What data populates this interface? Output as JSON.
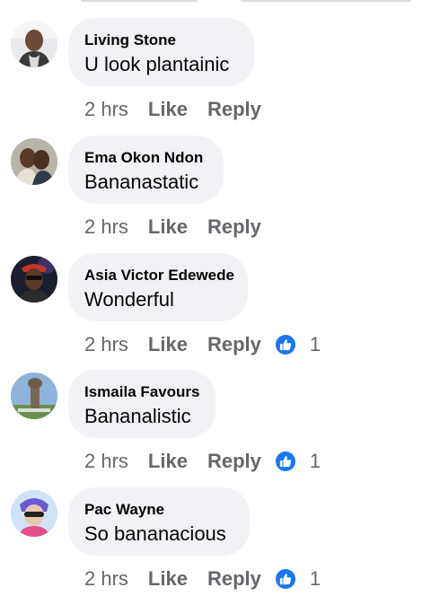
{
  "colors": {
    "bubble": "#f0f2f5",
    "secondary_text": "#65676b",
    "like_blue": "#1877f2"
  },
  "comments": [
    {
      "author": "Living Stone",
      "text": "U look plantainic",
      "time": "2 hrs",
      "like_label": "Like",
      "reply_label": "Reply",
      "reaction_count": null,
      "avatar": "avatar-living-stone"
    },
    {
      "author": "Ema Okon Ndon",
      "text": "Bananastatic",
      "time": "2 hrs",
      "like_label": "Like",
      "reply_label": "Reply",
      "reaction_count": null,
      "avatar": "avatar-ema-okon-ndon"
    },
    {
      "author": "Asia Victor Edewede",
      "text": "Wonderful",
      "time": "2 hrs",
      "like_label": "Like",
      "reply_label": "Reply",
      "reaction_count": "1",
      "reaction_icon": "thumbs-up-icon",
      "avatar": "avatar-asia-victor-edewede"
    },
    {
      "author": "Ismaila Favours",
      "text": "Bananalistic",
      "time": "2 hrs",
      "like_label": "Like",
      "reply_label": "Reply",
      "reaction_count": "1",
      "reaction_icon": "thumbs-up-icon",
      "avatar": "avatar-ismaila-favours"
    },
    {
      "author": "Pac Wayne",
      "text": "So bananacious",
      "time": "2 hrs",
      "like_label": "Like",
      "reply_label": "Reply",
      "reaction_count": "1",
      "reaction_icon": "thumbs-up-icon",
      "avatar": "avatar-pac-wayne"
    }
  ]
}
